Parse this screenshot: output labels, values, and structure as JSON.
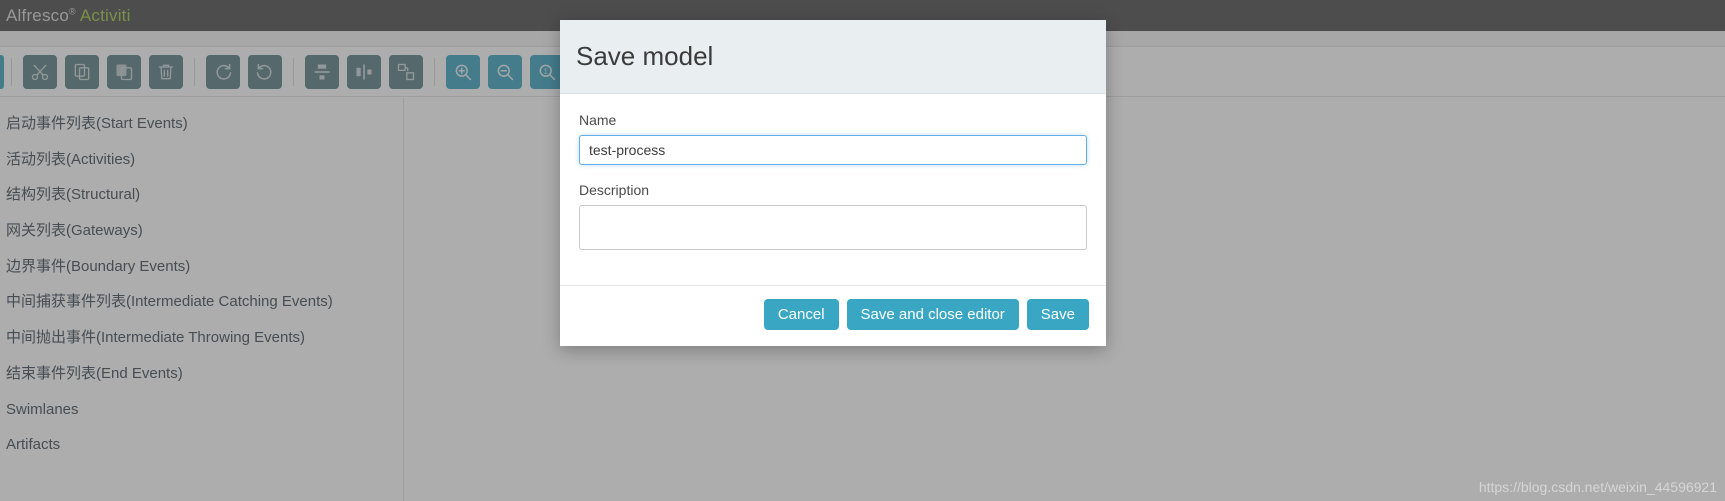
{
  "app": {
    "brand_primary": "Alfresco",
    "brand_sup": "®",
    "brand_secondary": "Activiti",
    "brand_color": "#a3c642",
    "topbar_color": "#4b4b4b"
  },
  "toolbar": {
    "accent_color": "#3aa3bf",
    "button_color": "#5a7d84",
    "items": [
      {
        "name": "cut-icon",
        "title": "Cut"
      },
      {
        "name": "copy-icon",
        "title": "Copy"
      },
      {
        "name": "paste-icon",
        "title": "Paste"
      },
      {
        "name": "delete-icon",
        "title": "Delete"
      },
      {
        "name": "redo-icon",
        "title": "Redo"
      },
      {
        "name": "undo-icon",
        "title": "Undo"
      },
      {
        "name": "align-vertical-icon",
        "title": "Align vertical"
      },
      {
        "name": "align-horizontal-icon",
        "title": "Align horizontal"
      },
      {
        "name": "same-size-icon",
        "title": "Same size"
      },
      {
        "name": "zoom-in-icon",
        "title": "Zoom in"
      },
      {
        "name": "zoom-out-icon",
        "title": "Zoom out"
      },
      {
        "name": "zoom-actual-icon",
        "title": "Zoom actual size"
      },
      {
        "name": "zoom-fit-icon",
        "title": "Zoom fit to screen"
      }
    ]
  },
  "palette": {
    "items": [
      {
        "label": "启动事件列表(Start Events)"
      },
      {
        "label": "活动列表(Activities)"
      },
      {
        "label": "结构列表(Structural)"
      },
      {
        "label": "网关列表(Gateways)"
      },
      {
        "label": "边界事件(Boundary Events)"
      },
      {
        "label": "中间捕获事件列表(Intermediate Catching Events)"
      },
      {
        "label": "中间抛出事件(Intermediate Throwing Events)"
      },
      {
        "label": "结束事件列表(End Events)"
      },
      {
        "label": "Swimlanes"
      },
      {
        "label": "Artifacts"
      }
    ]
  },
  "modal": {
    "title": "Save model",
    "name_label": "Name",
    "name_value": "test-process",
    "name_placeholder": "",
    "description_label": "Description",
    "description_value": "",
    "description_placeholder": "",
    "cancel_label": "Cancel",
    "save_and_close_label": "Save and close editor",
    "save_label": "Save",
    "button_color": "#39a7c4"
  },
  "watermark": {
    "text": "https://blog.csdn.net/weixin_44596921"
  }
}
